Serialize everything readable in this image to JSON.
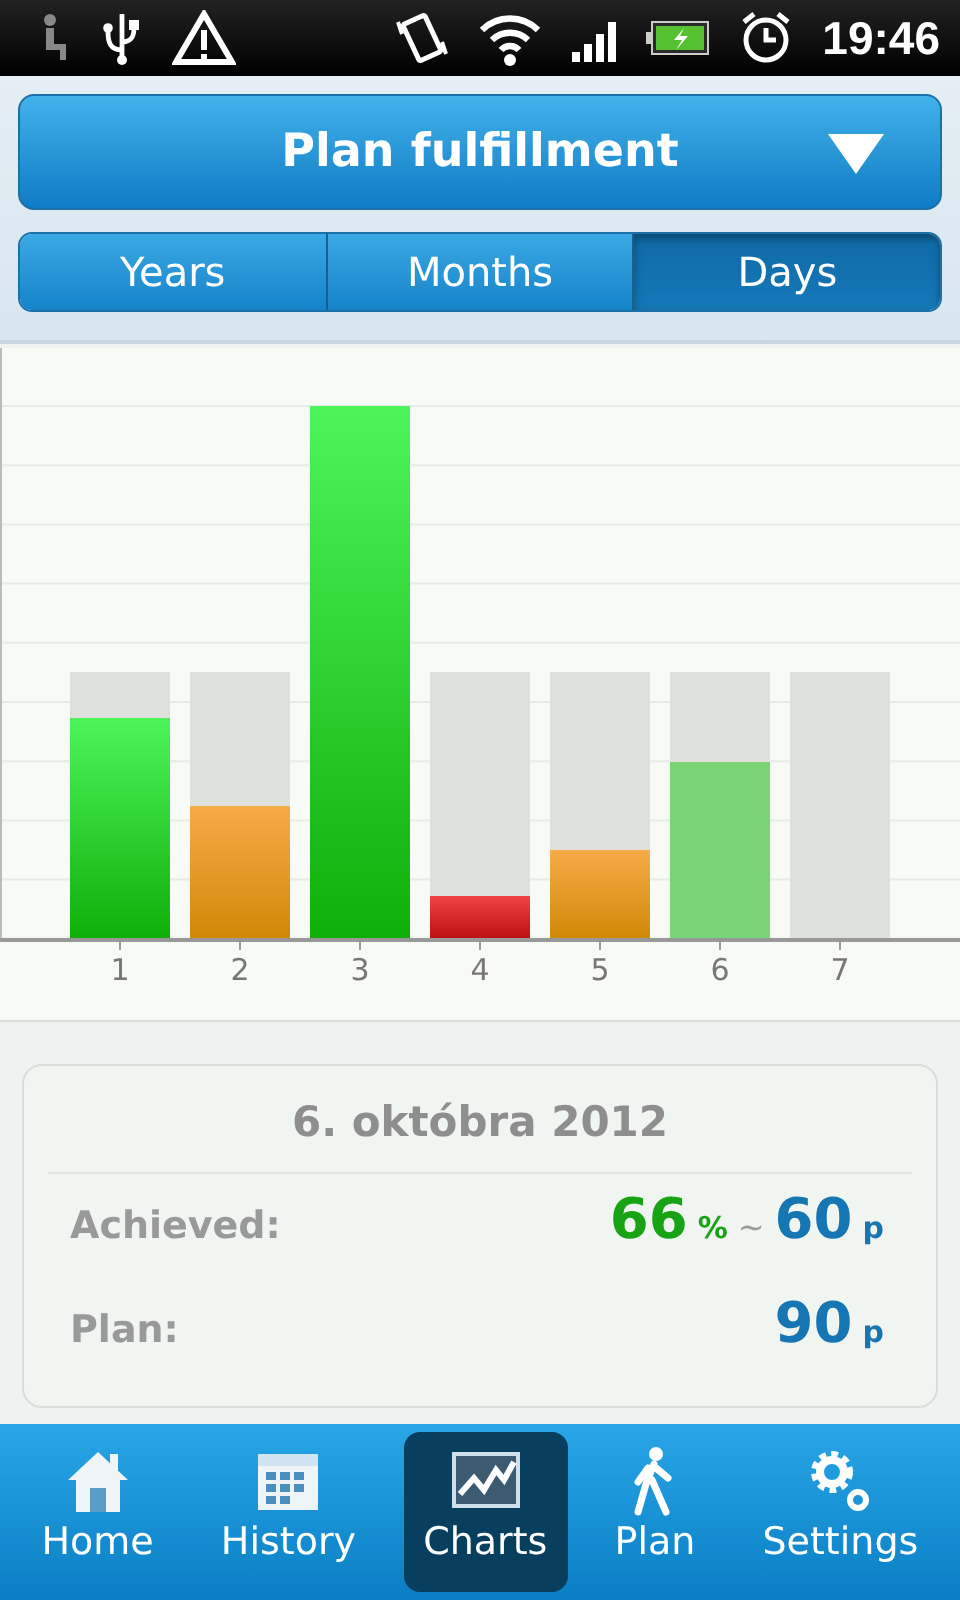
{
  "status_bar": {
    "time": "19:46"
  },
  "header": {
    "title": "Plan fulfillment"
  },
  "tabs": [
    {
      "label": "Years",
      "selected": false
    },
    {
      "label": "Months",
      "selected": false
    },
    {
      "label": "Days",
      "selected": true
    }
  ],
  "chart": {
    "x_labels": [
      "1",
      "2",
      "3",
      "4",
      "5",
      "6",
      "7"
    ]
  },
  "summary": {
    "date": "6. októbra 2012",
    "rows": [
      {
        "kind": "achieved",
        "label": "Achieved:",
        "percent": "66",
        "percent_unit": "%",
        "separator": "~",
        "value": "60",
        "unit": "p"
      },
      {
        "kind": "plan",
        "label": "Plan:",
        "value": "90",
        "unit": "p"
      }
    ]
  },
  "nav": [
    {
      "label": "Home",
      "selected": false
    },
    {
      "label": "History",
      "selected": false
    },
    {
      "label": "Charts",
      "selected": true
    },
    {
      "label": "Plan",
      "selected": false
    },
    {
      "label": "Settings",
      "selected": false
    }
  ]
}
